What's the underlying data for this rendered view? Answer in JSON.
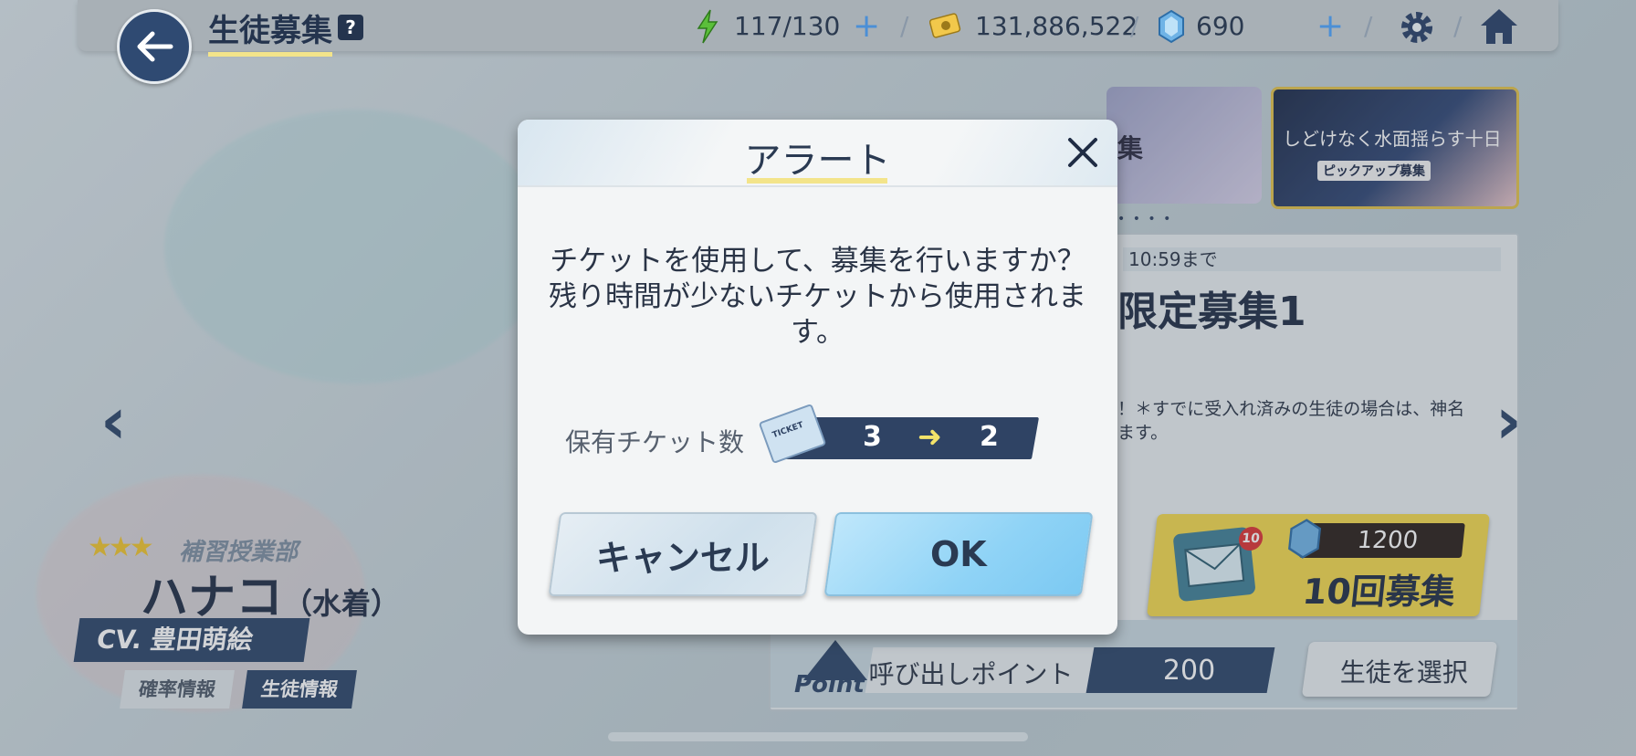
{
  "header": {
    "title": "生徒募集",
    "help": "?",
    "ap": "117/130",
    "credits": "131,886,522",
    "gems": "690",
    "separator": "/"
  },
  "banners": {
    "featured_text": "しどけなく水面揺らす十日",
    "featured_sub": "ピックアップ募集",
    "partial_text": "集"
  },
  "gacha": {
    "time_suffix": "10:59まで",
    "name_partial": "限定募集1",
    "desc_line1": "！＊すでに受入れ済みの生徒の場合は、神名",
    "desc_line2": "ます。",
    "ten_pull_cost": "1200",
    "ten_pull_label": "10回募集",
    "ten_badge": "10",
    "point_logo": "Point",
    "point_label": "呼び出しポイント",
    "point_value": "200",
    "select_student": "生徒を選択"
  },
  "character": {
    "stars": "★★★",
    "club": "補習授業部",
    "name": "ハナコ",
    "variant": "（水着）",
    "cv": "CV. 豊田萌絵",
    "rate_info": "確率情報",
    "student_info": "生徒情報"
  },
  "modal": {
    "title": "アラート",
    "message_lines": [
      "チケットを使用して、募集を行いますか？",
      "残り時間が少ないチケットから使用されま",
      "す。"
    ],
    "ticket_label": "保有チケット数",
    "ticket_icon_text": "TICKET",
    "ticket_from": "3",
    "ticket_to": "2",
    "cancel": "キャンセル",
    "ok": "OK"
  },
  "colors": {
    "navy": "#2f4364",
    "accent_yellow": "#f3e48a",
    "ok_blue": "#8fd3f6"
  }
}
